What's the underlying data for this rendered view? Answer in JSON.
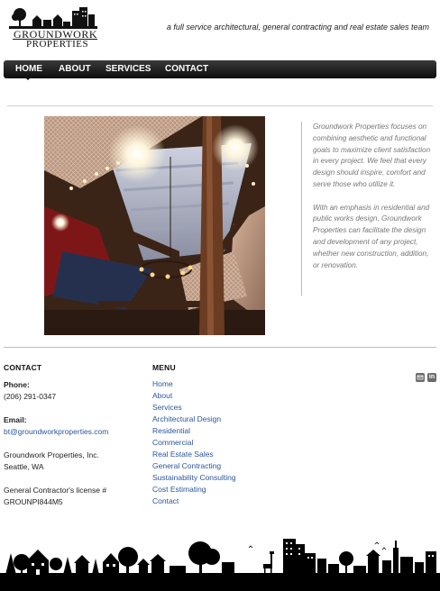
{
  "brand": {
    "logo_line1": "GROUNDWORK",
    "logo_line2": "PROPERTIES",
    "tagline": "a full service architectural, general contracting and real estate sales team"
  },
  "nav": {
    "items": [
      {
        "label": "HOME"
      },
      {
        "label": "ABOUT"
      },
      {
        "label": "SERVICES"
      },
      {
        "label": "CONTACT"
      }
    ],
    "active": "HOME"
  },
  "intro": {
    "p1": "Groundwork Properties focuses on combining aesthetic and functional goals to maximize client satisfaction in every project.  We feel that every design should inspire, comfort and serve those who utilize it.",
    "p2": "With an emphasis in residential and public works design, Groundwork Properties can facilitate the design and development of any project, whether new construction, addition, or renovation."
  },
  "contact": {
    "title": "CONTACT",
    "phone_label": "Phone:",
    "phone": "(206) 291-0347",
    "email_label": "Email:",
    "email": "bt@groundworkproperties.com",
    "company": "Groundwork Properties, Inc.",
    "location": "Seattle, WA",
    "license_label": "General Contractor's license #",
    "license": "GROUNPI844M5"
  },
  "menu": {
    "title": "MENU",
    "items": [
      "Home",
      "About",
      "Services",
      "Architectural Design",
      "Residential",
      "Commercial",
      "Real Estate Sales",
      "General Contracting",
      "Sustainability Consulting",
      "Cost Estimating",
      "Contact"
    ]
  },
  "social": {
    "icons": [
      "email-icon",
      "linkedin-icon"
    ],
    "linkedin_text": "in"
  },
  "colors": {
    "nav_bg": "#1a1a1a",
    "link": "#2a56a0",
    "intro_text": "#777777"
  }
}
